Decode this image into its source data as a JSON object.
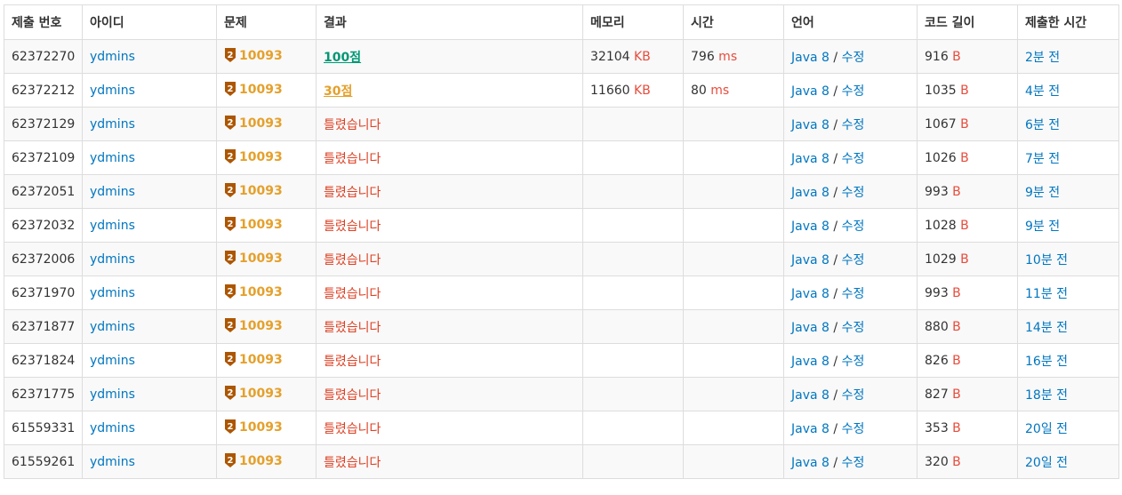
{
  "headers": [
    "제출 번호",
    "아이디",
    "문제",
    "결과",
    "메모리",
    "시간",
    "언어",
    "코드 길이",
    "제출한 시간"
  ],
  "units": {
    "memory": "KB",
    "time": "ms",
    "length": "B"
  },
  "tier_badge": {
    "icon": "bronze-2-tier-icon",
    "level": "2",
    "color": "#ad5600"
  },
  "colors": {
    "link": "#0076c0",
    "accepted": "#009874",
    "partial": "#e5a02b",
    "wrong": "#dd4124",
    "unit": "#e74c3c",
    "problem": "#e5a02b"
  },
  "rows": [
    {
      "id": "62372270",
      "user": "ydmins",
      "problem": "10093",
      "result": "100점",
      "result_type": "ac",
      "memory": "32104",
      "time": "796",
      "lang": "Java 8",
      "sep": " / ",
      "edit": "수정",
      "length": "916",
      "submitted": "2분 전"
    },
    {
      "id": "62372212",
      "user": "ydmins",
      "problem": "10093",
      "result": "30점",
      "result_type": "pac",
      "memory": "11660",
      "time": "80",
      "lang": "Java 8",
      "sep": " / ",
      "edit": "수정",
      "length": "1035",
      "submitted": "4분 전"
    },
    {
      "id": "62372129",
      "user": "ydmins",
      "problem": "10093",
      "result": "틀렸습니다",
      "result_type": "wa",
      "memory": "",
      "time": "",
      "lang": "Java 8",
      "sep": " / ",
      "edit": "수정",
      "length": "1067",
      "submitted": "6분 전"
    },
    {
      "id": "62372109",
      "user": "ydmins",
      "problem": "10093",
      "result": "틀렸습니다",
      "result_type": "wa",
      "memory": "",
      "time": "",
      "lang": "Java 8",
      "sep": " / ",
      "edit": "수정",
      "length": "1026",
      "submitted": "7분 전"
    },
    {
      "id": "62372051",
      "user": "ydmins",
      "problem": "10093",
      "result": "틀렸습니다",
      "result_type": "wa",
      "memory": "",
      "time": "",
      "lang": "Java 8",
      "sep": " / ",
      "edit": "수정",
      "length": "993",
      "submitted": "9분 전"
    },
    {
      "id": "62372032",
      "user": "ydmins",
      "problem": "10093",
      "result": "틀렸습니다",
      "result_type": "wa",
      "memory": "",
      "time": "",
      "lang": "Java 8",
      "sep": " / ",
      "edit": "수정",
      "length": "1028",
      "submitted": "9분 전"
    },
    {
      "id": "62372006",
      "user": "ydmins",
      "problem": "10093",
      "result": "틀렸습니다",
      "result_type": "wa",
      "memory": "",
      "time": "",
      "lang": "Java 8",
      "sep": " / ",
      "edit": "수정",
      "length": "1029",
      "submitted": "10분 전"
    },
    {
      "id": "62371970",
      "user": "ydmins",
      "problem": "10093",
      "result": "틀렸습니다",
      "result_type": "wa",
      "memory": "",
      "time": "",
      "lang": "Java 8",
      "sep": " / ",
      "edit": "수정",
      "length": "993",
      "submitted": "11분 전"
    },
    {
      "id": "62371877",
      "user": "ydmins",
      "problem": "10093",
      "result": "틀렸습니다",
      "result_type": "wa",
      "memory": "",
      "time": "",
      "lang": "Java 8",
      "sep": " / ",
      "edit": "수정",
      "length": "880",
      "submitted": "14분 전"
    },
    {
      "id": "62371824",
      "user": "ydmins",
      "problem": "10093",
      "result": "틀렸습니다",
      "result_type": "wa",
      "memory": "",
      "time": "",
      "lang": "Java 8",
      "sep": " / ",
      "edit": "수정",
      "length": "826",
      "submitted": "16분 전"
    },
    {
      "id": "62371775",
      "user": "ydmins",
      "problem": "10093",
      "result": "틀렸습니다",
      "result_type": "wa",
      "memory": "",
      "time": "",
      "lang": "Java 8",
      "sep": " / ",
      "edit": "수정",
      "length": "827",
      "submitted": "18분 전"
    },
    {
      "id": "61559331",
      "user": "ydmins",
      "problem": "10093",
      "result": "틀렸습니다",
      "result_type": "wa",
      "memory": "",
      "time": "",
      "lang": "Java 8",
      "sep": " / ",
      "edit": "수정",
      "length": "353",
      "submitted": "20일 전"
    },
    {
      "id": "61559261",
      "user": "ydmins",
      "problem": "10093",
      "result": "틀렸습니다",
      "result_type": "wa",
      "memory": "",
      "time": "",
      "lang": "Java 8",
      "sep": " / ",
      "edit": "수정",
      "length": "320",
      "submitted": "20일 전"
    }
  ]
}
